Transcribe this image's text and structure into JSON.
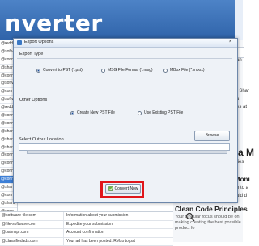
{
  "app": {
    "title": "nverter",
    "emails": [
      "@redd",
      "@softv",
      "@conn",
      "@shard",
      "@conn",
      "@softv",
      "@conn",
      "@softv",
      "@redd",
      "@conn",
      "@conn",
      "@shard",
      "@shard",
      "@shard",
      "@conn",
      "@conn",
      "@conn",
      "@conn",
      "@shard",
      "@conn",
      "@shard",
      "@conn",
      "@shard",
      "@shard",
      "@shard"
    ],
    "selected_email_index": 17,
    "table_rows": [
      {
        "from": "@software-file.com",
        "subject": "Information about your submission"
      },
      {
        "from": "@file-software.com",
        "subject": "Expedite your submission"
      },
      {
        "from": "@palmspr.com",
        "subject": "Account confirmation"
      },
      {
        "from": "@classifiedads.com",
        "subject": "Your ad has been posted. RMxo to pst"
      }
    ],
    "right_panel": {
      "frag1": "an",
      "frag2": "I Shar",
      "frag3": "u",
      "frag4": "es at",
      "frag5": "ta M",
      "frag6": "fies",
      "frag7": "Moni",
      "frag8": "n to a",
      "frag9": "uld d",
      "clean_title": "Clean Code Principles",
      "clean_text": "Your singular focus should be on making creating the best possible product fo"
    }
  },
  "dialog": {
    "title": "Export Options",
    "close_label": "×",
    "export_type_label": "Export Type",
    "export_options": [
      {
        "label": "Convert to PST (*.pst)",
        "selected": true
      },
      {
        "label": "MSG File Format (*.msg)",
        "selected": false
      },
      {
        "label": "MBox File (*.mbox)",
        "selected": false
      }
    ],
    "other_options_label": "Other Options",
    "pst_options": [
      {
        "label": "Create  New  PST  File",
        "selected": true
      },
      {
        "label": "Use Existing PST File",
        "selected": false
      }
    ],
    "output_location_label": "Select Output Location",
    "output_value": "",
    "browse_label": "Browse",
    "progress": 0,
    "convert_label": "Convert Now"
  },
  "colors": {
    "header": "#3a70b8",
    "highlight": "#e0161b",
    "selected_row": "#3d7fd6"
  }
}
